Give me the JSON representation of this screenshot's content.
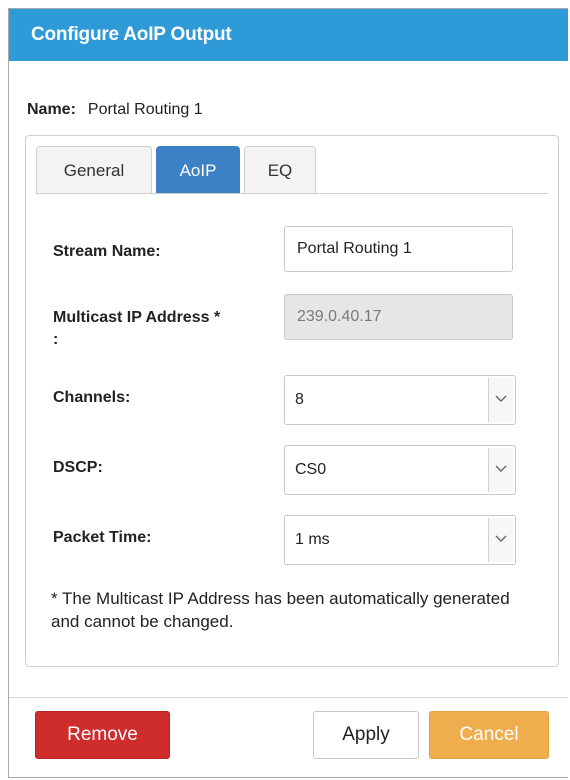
{
  "dialog": {
    "title": "Configure AoIP Output",
    "name_label": "Name:",
    "name_value": "Portal Routing 1"
  },
  "tabs": [
    {
      "label": "General",
      "active": false
    },
    {
      "label": "AoIP",
      "active": true
    },
    {
      "label": "EQ",
      "active": false
    }
  ],
  "form": {
    "stream_name": {
      "label": "Stream Name:",
      "value": "Portal Routing 1"
    },
    "multicast": {
      "label_line1": "Multicast IP Address *",
      "label_line2": ":",
      "value": "239.0.40.17",
      "disabled": true
    },
    "channels": {
      "label": "Channels:",
      "value": "8"
    },
    "dscp": {
      "label": "DSCP:",
      "value": "CS0"
    },
    "packet_time": {
      "label": "Packet Time:",
      "value": "1 ms"
    }
  },
  "note": "* The Multicast IP Address has been automatically generated and cannot be changed.",
  "buttons": {
    "remove": "Remove",
    "apply": "Apply",
    "cancel": "Cancel"
  },
  "colors": {
    "title_bar": "#2f9ad8",
    "active_tab": "#3c80c6",
    "remove": "#cf2c2c",
    "cancel": "#f0ad4e"
  },
  "icons": {
    "select_arrow": "chevron-down-icon"
  }
}
